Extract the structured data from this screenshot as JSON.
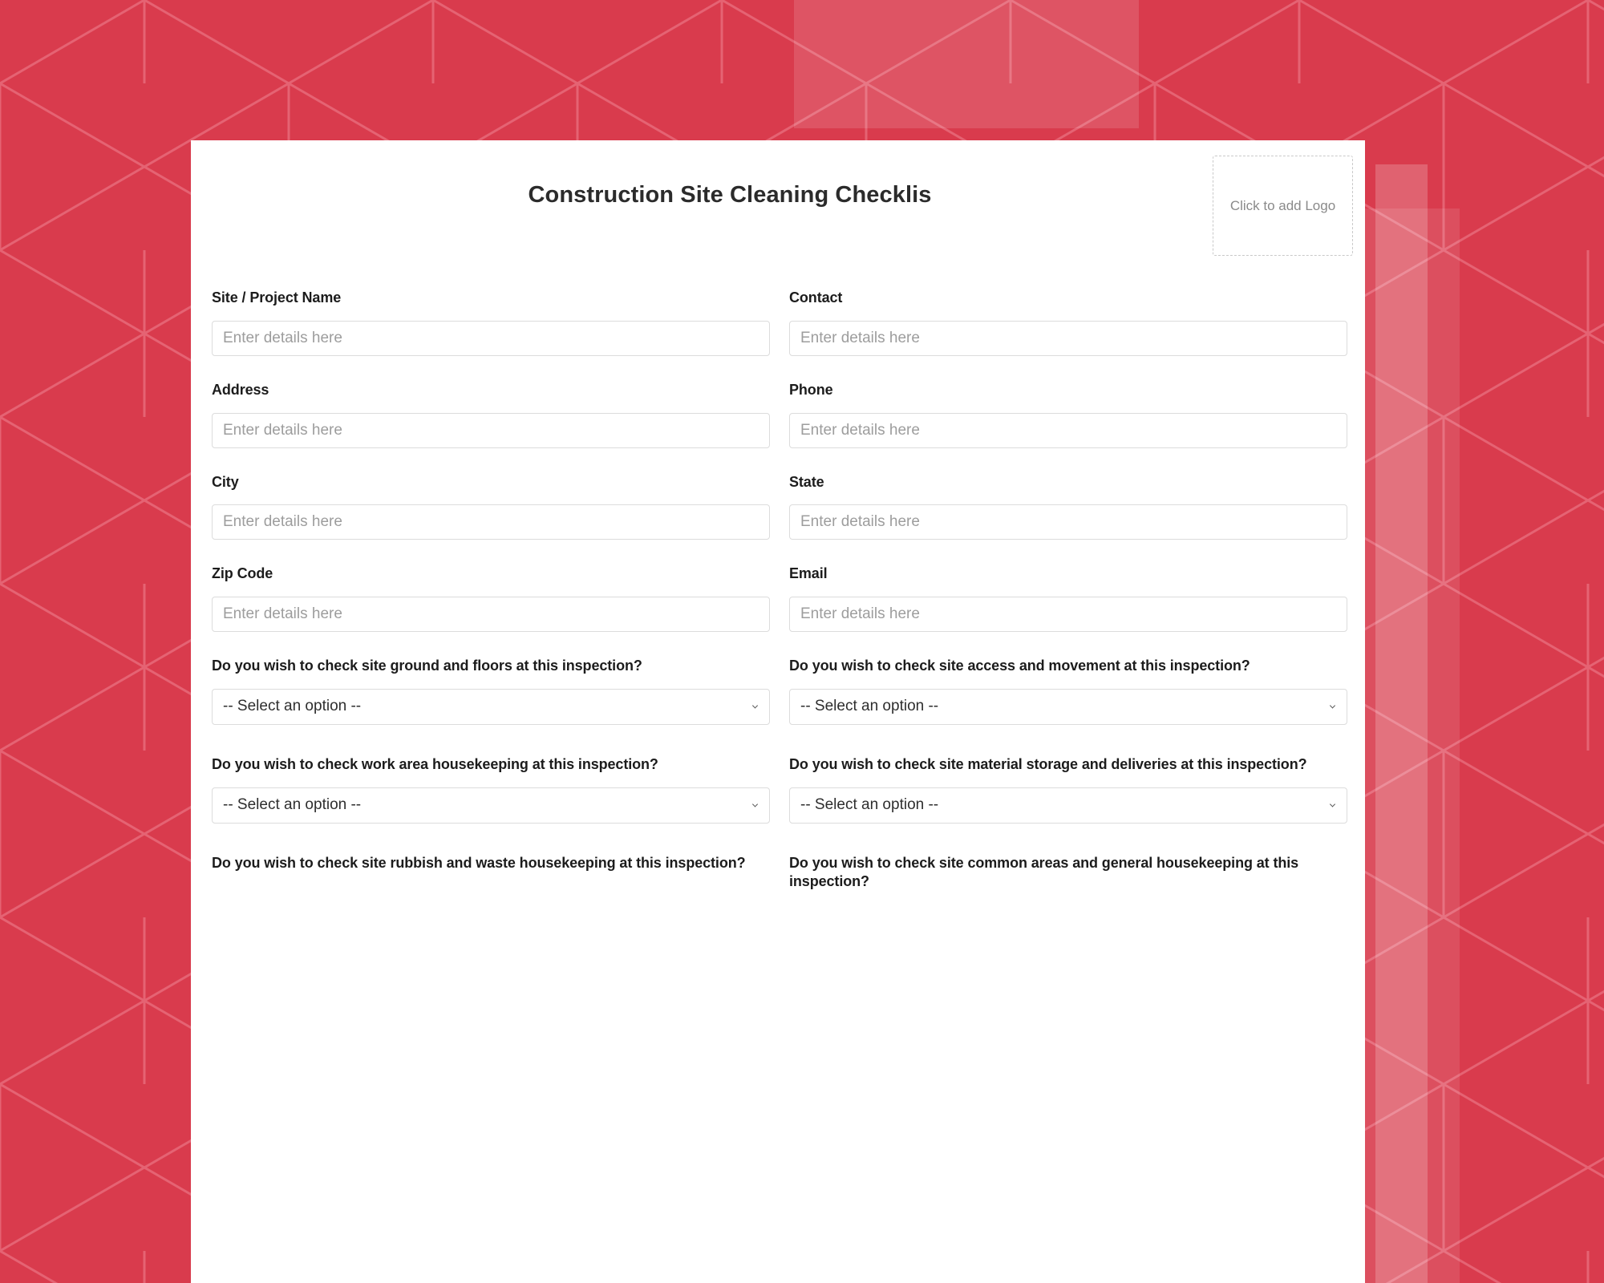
{
  "background": {
    "base_color": "#d93b4d",
    "line_color": "#e8697a",
    "overlay_color": "#ec8a96",
    "pattern": "hexagon-cube-geometric"
  },
  "card": {
    "title": "Construction Site Cleaning Checklis",
    "logo_placeholder": "Click to add Logo"
  },
  "fields": [
    {
      "label": "Site / Project Name",
      "placeholder": "Enter details here",
      "value": ""
    },
    {
      "label": "Contact",
      "placeholder": "Enter details here",
      "value": ""
    },
    {
      "label": "Address",
      "placeholder": "Enter details here",
      "value": ""
    },
    {
      "label": "Phone",
      "placeholder": "Enter details here",
      "value": ""
    },
    {
      "label": "City",
      "placeholder": "Enter details here",
      "value": ""
    },
    {
      "label": "State",
      "placeholder": "Enter details here",
      "value": ""
    },
    {
      "label": "Zip Code",
      "placeholder": "Enter details here",
      "value": ""
    },
    {
      "label": "Email",
      "placeholder": "Enter details here",
      "value": ""
    }
  ],
  "questions": [
    {
      "label": "Do you wish to check site ground and floors at this inspection?",
      "selected": "-- Select an option --",
      "has_select": true
    },
    {
      "label": "Do you wish to check site access and movement at this inspection?",
      "selected": "-- Select an option --",
      "has_select": true
    },
    {
      "label": "Do you wish to check work area housekeeping at this inspection?",
      "selected": "-- Select an option --",
      "has_select": true
    },
    {
      "label": "Do you wish to check site material storage and deliveries at this inspection?",
      "selected": "-- Select an option --",
      "has_select": true
    },
    {
      "label": "Do you wish to check site rubbish and waste housekeeping at this inspection?",
      "selected": "",
      "has_select": false
    },
    {
      "label": "Do you wish to check site common areas and general housekeeping at this inspection?",
      "selected": "",
      "has_select": false
    }
  ]
}
